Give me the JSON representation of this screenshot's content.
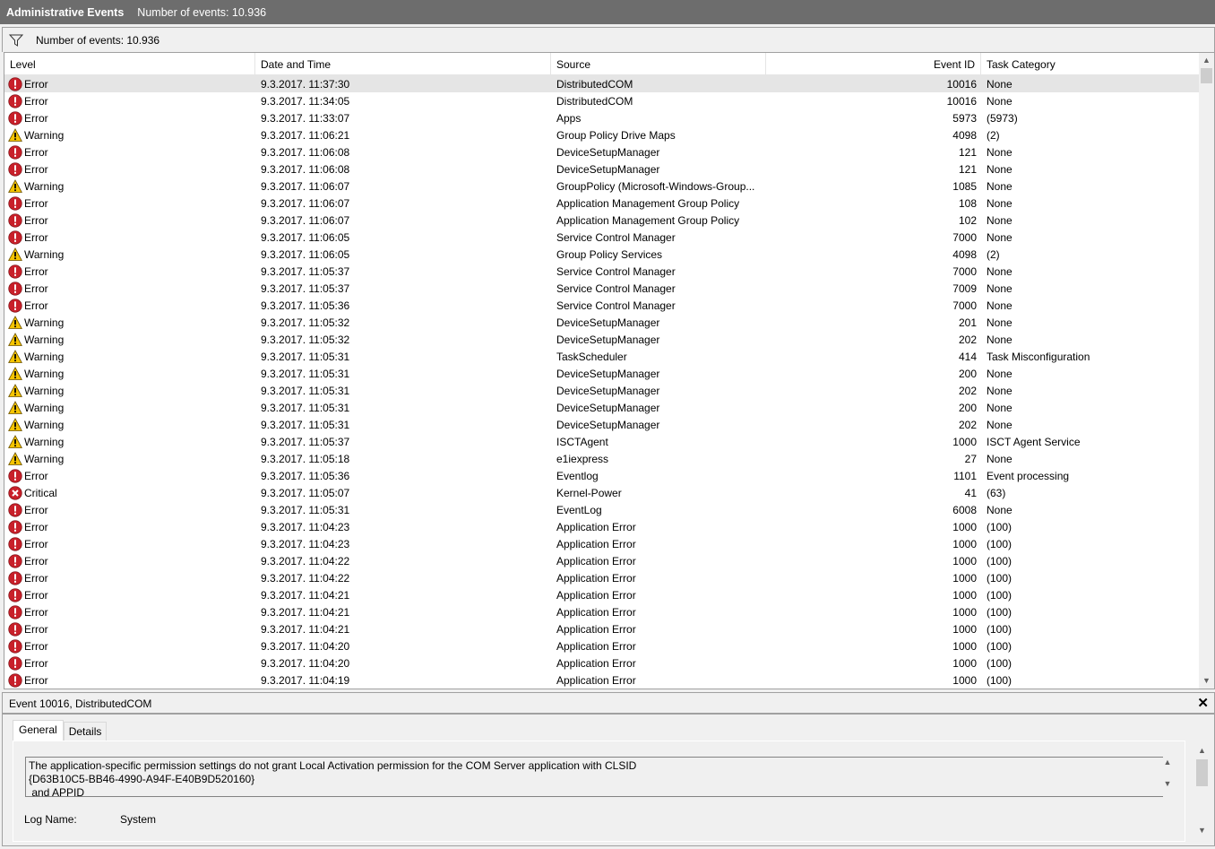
{
  "titlebar": {
    "title": "Administrative Events",
    "count": "Number of events: 10.936"
  },
  "filterbar": {
    "icon": "filter-icon",
    "count": "Number of events: 10.936"
  },
  "columns": [
    "Level",
    "Date and Time",
    "Source",
    "Event ID",
    "Task Category"
  ],
  "rows": [
    [
      "Error",
      "9.3.2017. 11:37:30",
      "DistributedCOM",
      "10016",
      "None"
    ],
    [
      "Error",
      "9.3.2017. 11:34:05",
      "DistributedCOM",
      "10016",
      "None"
    ],
    [
      "Error",
      "9.3.2017. 11:33:07",
      "Apps",
      "5973",
      "(5973)"
    ],
    [
      "Warning",
      "9.3.2017. 11:06:21",
      "Group Policy Drive Maps",
      "4098",
      "(2)"
    ],
    [
      "Error",
      "9.3.2017. 11:06:08",
      "DeviceSetupManager",
      "121",
      "None"
    ],
    [
      "Error",
      "9.3.2017. 11:06:08",
      "DeviceSetupManager",
      "121",
      "None"
    ],
    [
      "Warning",
      "9.3.2017. 11:06:07",
      "GroupPolicy (Microsoft-Windows-Group...",
      "1085",
      "None"
    ],
    [
      "Error",
      "9.3.2017. 11:06:07",
      "Application Management Group Policy",
      "108",
      "None"
    ],
    [
      "Error",
      "9.3.2017. 11:06:07",
      "Application Management Group Policy",
      "102",
      "None"
    ],
    [
      "Error",
      "9.3.2017. 11:06:05",
      "Service Control Manager",
      "7000",
      "None"
    ],
    [
      "Warning",
      "9.3.2017. 11:06:05",
      "Group Policy Services",
      "4098",
      "(2)"
    ],
    [
      "Error",
      "9.3.2017. 11:05:37",
      "Service Control Manager",
      "7000",
      "None"
    ],
    [
      "Error",
      "9.3.2017. 11:05:37",
      "Service Control Manager",
      "7009",
      "None"
    ],
    [
      "Error",
      "9.3.2017. 11:05:36",
      "Service Control Manager",
      "7000",
      "None"
    ],
    [
      "Warning",
      "9.3.2017. 11:05:32",
      "DeviceSetupManager",
      "201",
      "None"
    ],
    [
      "Warning",
      "9.3.2017. 11:05:32",
      "DeviceSetupManager",
      "202",
      "None"
    ],
    [
      "Warning",
      "9.3.2017. 11:05:31",
      "TaskScheduler",
      "414",
      "Task Misconfiguration"
    ],
    [
      "Warning",
      "9.3.2017. 11:05:31",
      "DeviceSetupManager",
      "200",
      "None"
    ],
    [
      "Warning",
      "9.3.2017. 11:05:31",
      "DeviceSetupManager",
      "202",
      "None"
    ],
    [
      "Warning",
      "9.3.2017. 11:05:31",
      "DeviceSetupManager",
      "200",
      "None"
    ],
    [
      "Warning",
      "9.3.2017. 11:05:31",
      "DeviceSetupManager",
      "202",
      "None"
    ],
    [
      "Warning",
      "9.3.2017. 11:05:37",
      "ISCTAgent",
      "1000",
      "ISCT Agent Service"
    ],
    [
      "Warning",
      "9.3.2017. 11:05:18",
      "e1iexpress",
      "27",
      "None"
    ],
    [
      "Error",
      "9.3.2017. 11:05:36",
      "Eventlog",
      "1101",
      "Event processing"
    ],
    [
      "Critical",
      "9.3.2017. 11:05:07",
      "Kernel-Power",
      "41",
      "(63)"
    ],
    [
      "Error",
      "9.3.2017. 11:05:31",
      "EventLog",
      "6008",
      "None"
    ],
    [
      "Error",
      "9.3.2017. 11:04:23",
      "Application Error",
      "1000",
      "(100)"
    ],
    [
      "Error",
      "9.3.2017. 11:04:23",
      "Application Error",
      "1000",
      "(100)"
    ],
    [
      "Error",
      "9.3.2017. 11:04:22",
      "Application Error",
      "1000",
      "(100)"
    ],
    [
      "Error",
      "9.3.2017. 11:04:22",
      "Application Error",
      "1000",
      "(100)"
    ],
    [
      "Error",
      "9.3.2017. 11:04:21",
      "Application Error",
      "1000",
      "(100)"
    ],
    [
      "Error",
      "9.3.2017. 11:04:21",
      "Application Error",
      "1000",
      "(100)"
    ],
    [
      "Error",
      "9.3.2017. 11:04:21",
      "Application Error",
      "1000",
      "(100)"
    ],
    [
      "Error",
      "9.3.2017. 11:04:20",
      "Application Error",
      "1000",
      "(100)"
    ],
    [
      "Error",
      "9.3.2017. 11:04:20",
      "Application Error",
      "1000",
      "(100)"
    ],
    [
      "Error",
      "9.3.2017. 11:04:19",
      "Application Error",
      "1000",
      "(100)"
    ]
  ],
  "detail": {
    "title": "Event 10016, DistributedCOM",
    "tabs": [
      "General",
      "Details"
    ],
    "message": "The application-specific permission settings do not grant Local Activation permission for the COM Server application with CLSID \n{D63B10C5-BB46-4990-A94F-E40B9D520160}\n and APPID",
    "log_name_label": "Log Name:",
    "log_name_value": "System"
  },
  "colors": {
    "error": "#c8202a",
    "warning": "#f5c400",
    "selected": "#e5e5e5"
  }
}
